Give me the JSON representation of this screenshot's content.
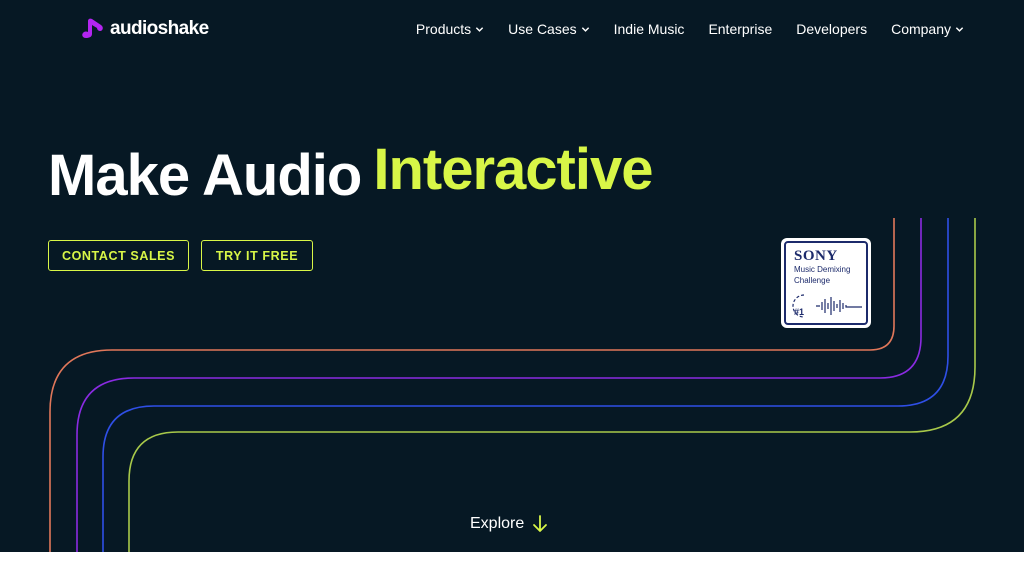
{
  "brand": {
    "name": "audioshake"
  },
  "nav": {
    "items": [
      {
        "label": "Products",
        "dropdown": true
      },
      {
        "label": "Use Cases",
        "dropdown": true
      },
      {
        "label": "Indie Music",
        "dropdown": false
      },
      {
        "label": "Enterprise",
        "dropdown": false
      },
      {
        "label": "Developers",
        "dropdown": false
      },
      {
        "label": "Company",
        "dropdown": true
      }
    ]
  },
  "hero": {
    "headline_part1": "Make Audio",
    "headline_part2": "Interactive",
    "cta_primary": "CONTACT SALES",
    "cta_secondary": "TRY IT FREE",
    "explore_label": "Explore"
  },
  "badge": {
    "brand": "SONY",
    "line1": "Music Demixing",
    "line2": "Challenge",
    "rank": "#1"
  },
  "colors": {
    "background": "#061824",
    "accent": "#d8f647",
    "logo": "#b325f0",
    "line_orange": "#e0775a",
    "line_purple": "#8a2be2",
    "line_blue": "#2f4fe6",
    "line_green": "#a8c94a"
  },
  "icons": {
    "logo": "audioshake-logo-icon",
    "dropdown": "chevron-down-icon",
    "explore": "arrow-down-icon"
  }
}
